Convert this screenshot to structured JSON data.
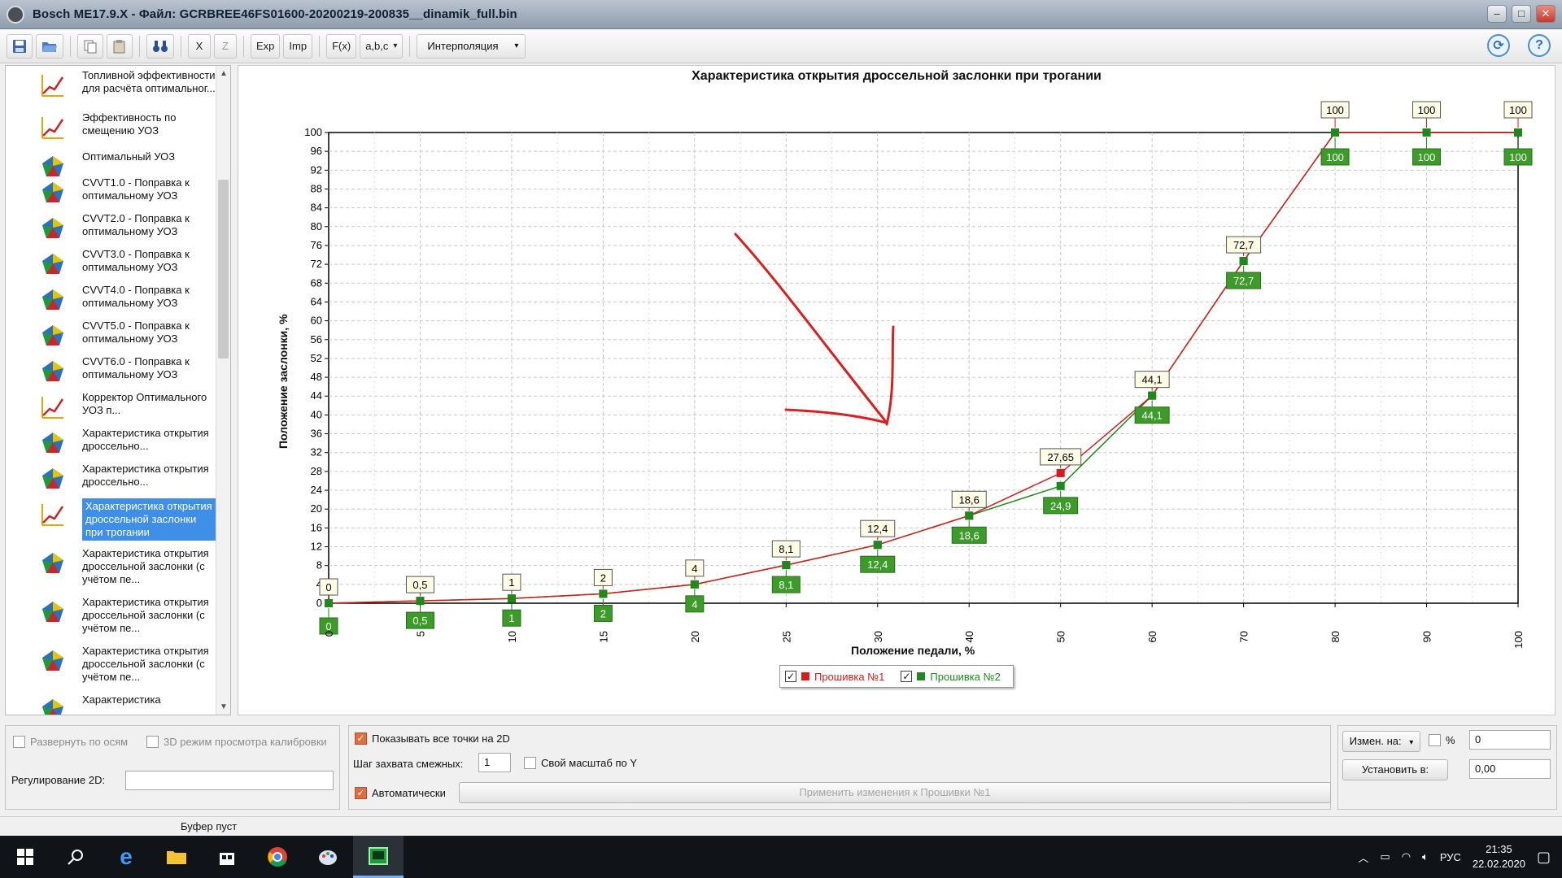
{
  "window": {
    "title": "Bosch ME17.9.X - Файл: GCRBREE46FS01600-20200219-200835__dinamik_full.bin"
  },
  "toolbar": {
    "exp": "Exp",
    "imp": "Imp",
    "x": "X",
    "z": "Z",
    "fx": "F(x)",
    "abc": "a,b,c",
    "interp": "Интерполяция",
    "dropdown_arrow": "▾",
    "help": "?"
  },
  "sidebar": {
    "items": [
      {
        "label": "Топливной эффективности для расчёта оптимальног...",
        "icon": "line-graph-icon"
      },
      {
        "label": "Эффективность по смещению УОЗ",
        "icon": "line-graph-icon"
      },
      {
        "label": "Оптимальный УОЗ",
        "icon": "surface-3d-icon"
      },
      {
        "label": "CVVT1.0 - Поправка к оптимальному УОЗ",
        "icon": "surface-3d-icon"
      },
      {
        "label": "CVVT2.0 - Поправка к оптимальному УОЗ",
        "icon": "surface-3d-icon"
      },
      {
        "label": "CVVT3.0 - Поправка к оптимальному УОЗ",
        "icon": "surface-3d-icon"
      },
      {
        "label": "CVVT4.0 - Поправка к оптимальному УОЗ",
        "icon": "surface-3d-icon"
      },
      {
        "label": "CVVT5.0 - Поправка к оптимальному УОЗ",
        "icon": "surface-3d-icon"
      },
      {
        "label": "CVVT6.0 - Поправка к оптимальному УОЗ",
        "icon": "surface-3d-icon"
      },
      {
        "label": "Корректор Оптимального УОЗ п...",
        "icon": "line-graph-icon"
      },
      {
        "label": "Характеристика открытия дроссельно...",
        "icon": "surface-3d-icon"
      },
      {
        "label": "Характеристика открытия дроссельно...",
        "icon": "surface-3d-icon"
      },
      {
        "label": "Характеристика открытия дроссельной заслонки при трогании",
        "icon": "line-graph-icon",
        "selected": true
      },
      {
        "label": "Характеристика открытия дроссельной заслонки (с учётом пе...",
        "icon": "surface-3d-icon"
      },
      {
        "label": "Характеристика открытия дроссельной заслонки (с учётом пе...",
        "icon": "surface-3d-icon"
      },
      {
        "label": "Характеристика открытия дроссельной заслонки (с учётом пе...",
        "icon": "surface-3d-icon"
      },
      {
        "label": "Характеристика",
        "icon": "surface-3d-icon"
      }
    ]
  },
  "chart_data": {
    "type": "line",
    "title": "Характеристика открытия дроссельной заслонки при трогании",
    "xlabel": "Положение педали, %",
    "ylabel": "Положение заслонки, %",
    "x": [
      0,
      5,
      10,
      15,
      20,
      25,
      30,
      40,
      50,
      60,
      70,
      80,
      90,
      100
    ],
    "x_tick_labels": [
      "0",
      "5",
      "10",
      "15",
      "20",
      "25",
      "30",
      "40",
      "50",
      "60",
      "70",
      "80",
      "90",
      "100"
    ],
    "ylim": [
      0,
      100
    ],
    "y_ticks": [
      0,
      4,
      8,
      12,
      16,
      20,
      24,
      28,
      32,
      36,
      40,
      44,
      48,
      52,
      56,
      60,
      64,
      68,
      72,
      76,
      80,
      84,
      88,
      92,
      96,
      100
    ],
    "grid": true,
    "x_spacing": "categorical (equal spacing per breakpoint)",
    "series": [
      {
        "name": "Прошивка №1",
        "color": "#d81b1b",
        "values": [
          0,
          0.5,
          1,
          2,
          4,
          8.1,
          12.4,
          18.6,
          27.65,
          44.1,
          72.7,
          100,
          100,
          100,
          100,
          100
        ],
        "labels": [
          "0",
          "0,5",
          "1",
          "2",
          "4",
          "8,1",
          "12,4",
          "18,6",
          "27,65",
          "44,1",
          "72,7",
          "100",
          "100",
          "100",
          "100",
          "100"
        ]
      },
      {
        "name": "Прошивка №2",
        "color": "#1e8a1e",
        "values": [
          0,
          0.5,
          1,
          2,
          4,
          8.1,
          12.4,
          18.6,
          24.9,
          44.1,
          72.7,
          100,
          100,
          100,
          100,
          100
        ],
        "labels": [
          "0",
          "0,5",
          "1",
          "2",
          "4",
          "8,1",
          "12,4",
          "18,6",
          "24,9",
          "44,1",
          "72,7",
          "100",
          "100",
          "100",
          "100",
          "100"
        ]
      }
    ],
    "legend": "bottom-center",
    "annotation": "hand-drawn red arrow pointing at x=25"
  },
  "bottom": {
    "expand_axes": "Развернуть по осям",
    "mode3d": "3D режим просмотра калибровки",
    "reg2d_label": "Регулирование 2D:",
    "show_all_points": "Показывать все точки на 2D",
    "step_label": "Шаг захвата смежных:",
    "step_value": "1",
    "own_scale": "Свой масштаб по Y",
    "auto": "Автоматически",
    "apply_btn": "Применить изменения к Прошивки №1",
    "change_by": "Измен. на:",
    "percent": "%",
    "change_value": "0",
    "set_to": "Установить в:",
    "set_value": "0,00"
  },
  "status": {
    "buffer": "Буфер пуст"
  },
  "tray": {
    "lang": "РУС",
    "time": "21:35",
    "date": "22.02.2020"
  }
}
